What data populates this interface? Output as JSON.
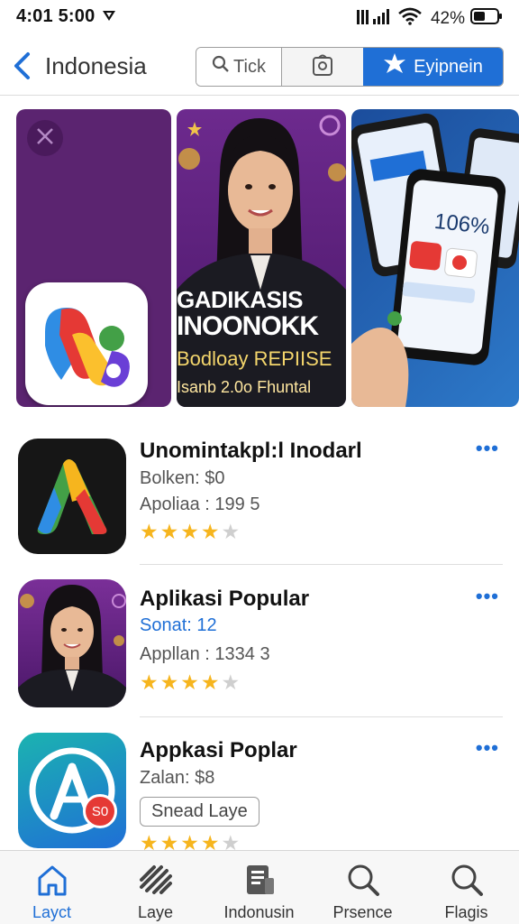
{
  "status_bar": {
    "time": "4:01 5:00",
    "battery_percent": "42%"
  },
  "header": {
    "back_label": "",
    "title": "Indonesia",
    "segments": [
      {
        "label": "Tick",
        "icon": "search-icon"
      },
      {
        "label": "",
        "icon": "bag-icon"
      },
      {
        "label": "Eyipnein",
        "icon": "star-burst-icon"
      }
    ]
  },
  "carousel": {
    "promo": {
      "line1": "GADIKASIS",
      "line2": "INOONOKK",
      "line3": "Bodloay REPIISE",
      "line4": "Isanb 2.0o Fhuntal"
    },
    "phone_stat": "106%"
  },
  "apps": [
    {
      "name": "Unomintakpl:l Inodarl",
      "line1": "Bolken: $0",
      "line2": "Apoliaa : 199 5",
      "rating": 4,
      "rating_max": 5
    },
    {
      "name": "Aplikasi Popular",
      "line1": "Sonat: 12",
      "line2": "Appllan : 1334 3",
      "rating": 4,
      "rating_max": 5
    },
    {
      "name": "Appkasi Poplar",
      "line1": "Zalan: $8",
      "button": "Snead Laye",
      "badge": "S0",
      "rating": 4,
      "rating_max": 5
    }
  ],
  "more_label": "•••",
  "tabs": [
    {
      "label": "Layct",
      "icon": "home-icon",
      "active": true
    },
    {
      "label": "Laye",
      "icon": "layers-icon",
      "active": false
    },
    {
      "label": "Indonusin",
      "icon": "document-icon",
      "active": false
    },
    {
      "label": "Prsence",
      "icon": "search-icon",
      "active": false
    },
    {
      "label": "Flagis",
      "icon": "search-icon",
      "active": false
    }
  ],
  "colors": {
    "accent": "#1f6fd6",
    "star": "#f6b51e",
    "promo_bg": "#5b2470"
  }
}
